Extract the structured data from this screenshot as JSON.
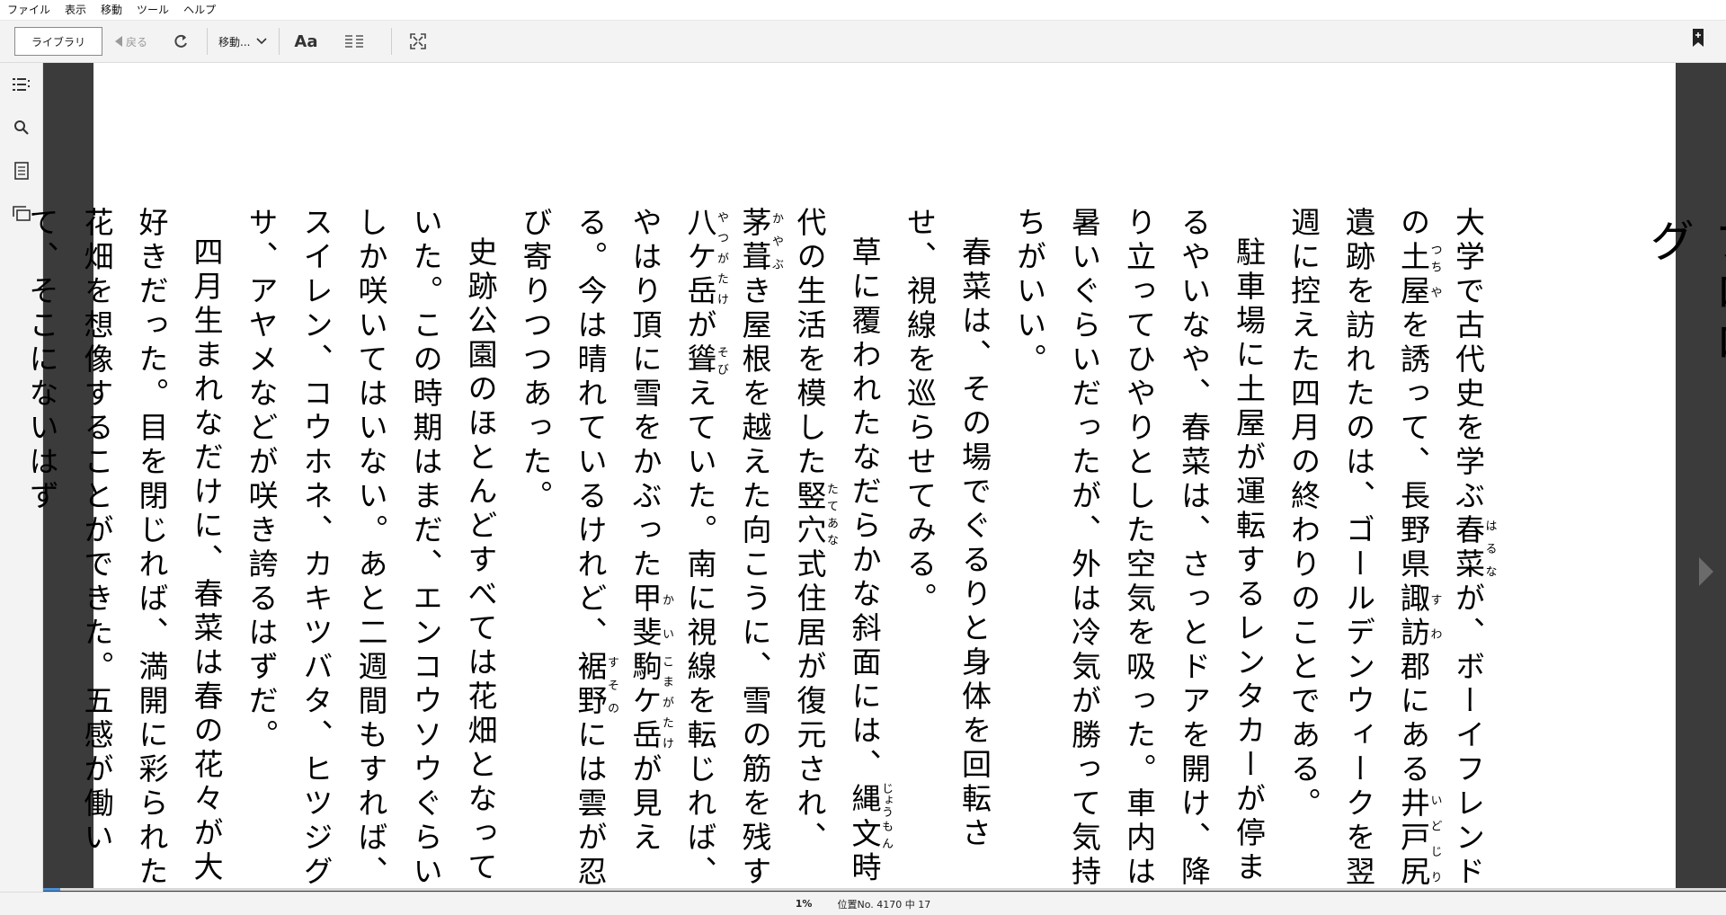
{
  "menu": {
    "items": [
      "ファイル",
      "表示",
      "移動",
      "ツール",
      "ヘルプ"
    ]
  },
  "toolbar": {
    "library_label": "ライブラリ",
    "back_label": "戻る",
    "goto_label": "移動...",
    "font_label": "Aa"
  },
  "book": {
    "chapter_title": "プロローグ",
    "paragraphs": [
      [
        "大学で古代史を学ぶ",
        {
          "base": "春菜",
          "ruby": "はるな"
        },
        "が、ボーイフレンドの",
        {
          "base": "土",
          "ruby": "つち"
        },
        {
          "base": "屋",
          "ruby": "や"
        },
        "を誘って、長野県",
        {
          "base": "諏訪",
          "ruby": "すわ"
        },
        "郡にある",
        {
          "base": "井戸尻",
          "ruby": "いどじり"
        },
        "遺跡を訪れたのは、ゴールデンウィークを翌週に控えた四月の終わりのことである。"
      ],
      [
        "駐車場に土屋が運転するレンタカーが停まるやいなや、春菜は、さっとドアを開け、降り立ってひやりとした空気を吸った。車内は暑いぐらいだったが、外は冷気が勝って気持ちがいい。"
      ],
      [
        "春菜は、その場でぐるりと身体を回転させ、視線を巡らせてみる。"
      ],
      [
        "草に覆われたなだらかな斜面には、",
        {
          "base": "縄",
          "ruby": "じょう"
        },
        {
          "base": "文",
          "ruby": "もん"
        },
        "時代の生活を模した",
        {
          "base": "竪穴",
          "ruby": "たてあな"
        },
        "式住居が復元され、",
        {
          "base": "茅葺",
          "ruby": "かやぶ"
        },
        "き屋根を越えた向こうに、雪の筋を残す",
        {
          "base": "八ケ岳",
          "ruby": "やつがたけ"
        },
        "が",
        {
          "base": "聳",
          "ruby": "そび"
        },
        "えていた。南に視線を転じれば、やはり頂に雪をかぶった",
        {
          "base": "甲斐",
          "ruby": "かい"
        },
        {
          "base": "駒ケ岳",
          "ruby": "こまがたけ"
        },
        "が見える。今は晴れているけれど、",
        {
          "base": "裾野",
          "ruby": "すその"
        },
        "には雲が忍び寄りつつあった。"
      ],
      [
        "史跡公園のほとんどすべては花畑となっていた。この時期はまだ、エンコウソウぐらいしか咲いてはいない。あと二週間もすれば、スイレン、コウホネ、カキツバタ、ヒツジグサ、アヤメなどが咲き誇るはずだ。"
      ],
      [
        "四月生まれなだけに、春菜は春の花々が大好きだった。目を閉じれば、満開に彩られた花畑を想像することができた。五感が働いて、そこにないはず"
      ]
    ]
  },
  "status": {
    "percent": "1%",
    "percent_value": 0.01,
    "location": "位置No. 4170 中 17"
  },
  "colors": {
    "reader_background": "#3b3b3b",
    "chrome": "#f3f3f3",
    "progress": "#4a90d9"
  }
}
